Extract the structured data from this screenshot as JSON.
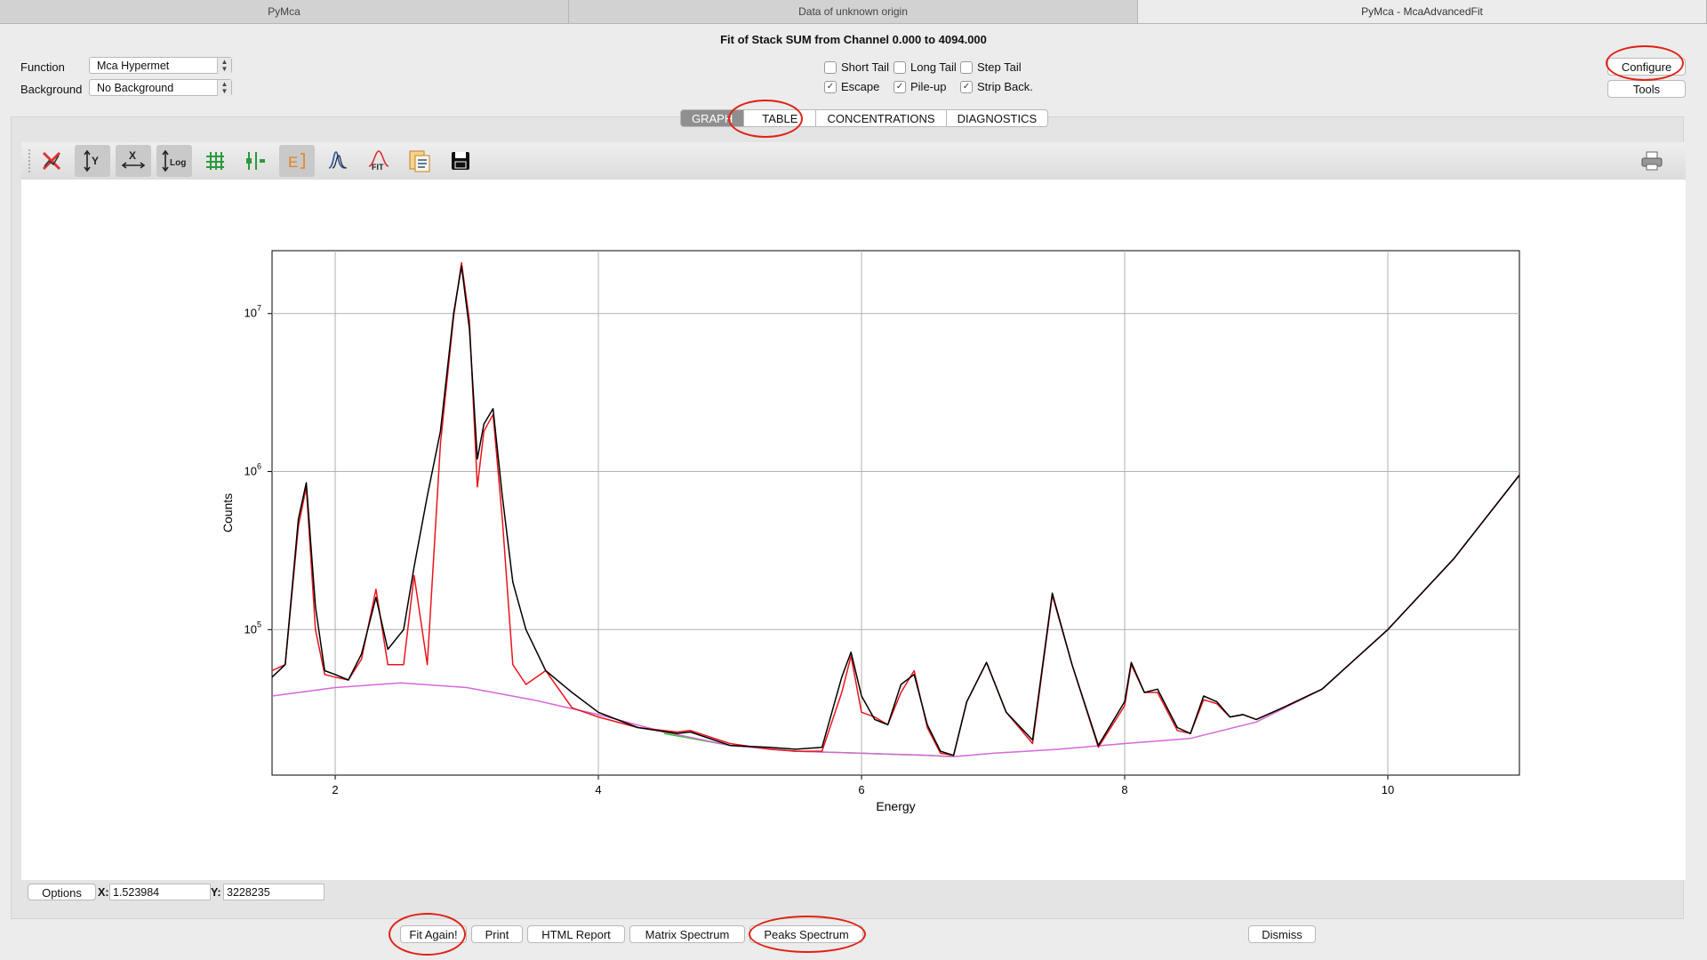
{
  "window_tabs": [
    "PyMca",
    "Data of unknown origin",
    "PyMca - McaAdvancedFit"
  ],
  "title": "Fit of Stack SUM from Channel 0.000 to 4094.000",
  "function": {
    "label": "Function",
    "value": "Mca Hypermet"
  },
  "background": {
    "label": "Background",
    "value": "No Background"
  },
  "options": [
    {
      "label": "Short Tail",
      "checked": false
    },
    {
      "label": "Long Tail",
      "checked": false
    },
    {
      "label": "Step Tail",
      "checked": false
    },
    {
      "label": "Escape",
      "checked": true
    },
    {
      "label": "Pile-up",
      "checked": true
    },
    {
      "label": "Strip Back.",
      "checked": true
    }
  ],
  "configure_label": "Configure",
  "tools_label": "Tools",
  "view_tabs": [
    "GRAPH",
    "TABLE",
    "CONCENTRATIONS",
    "DIAGNOSTICS"
  ],
  "selected_view_tab": "GRAPH",
  "toolbar_icons": [
    "reset-zoom-icon",
    "autoscale-y-icon",
    "autoscale-x-icon",
    "log-y-icon",
    "grid-icon",
    "curve-style-icon",
    "energy-axis-icon",
    "peak-icon",
    "fit-icon",
    "report-icon",
    "save-icon",
    "print-icon"
  ],
  "status": {
    "options_label": "Options",
    "x_label": "X:",
    "x_value": "1.523984",
    "y_label": "Y:",
    "y_value": "3228235"
  },
  "actions": {
    "fit_again": "Fit Again!",
    "print": "Print",
    "html_report": "HTML Report",
    "matrix_spectrum": "Matrix Spectrum",
    "peaks_spectrum": "Peaks Spectrum",
    "dismiss": "Dismiss"
  },
  "colors": {
    "data": "#000000",
    "fit": "#e8151b",
    "continuum": "#d668d6",
    "pileup": "#22d022",
    "annotation": "#e02214"
  },
  "chart_data": {
    "type": "line",
    "xlabel": "Energy",
    "ylabel": "Counts",
    "yscale": "log",
    "xlim": [
      1.52,
      11.0
    ],
    "ylim": [
      12000,
      25000000
    ],
    "xticks": [
      2,
      4,
      6,
      8,
      10
    ],
    "yticks": [
      "10^5",
      "10^6",
      "10^7"
    ],
    "grid": true,
    "series": [
      {
        "name": "data",
        "x": [
          1.52,
          1.62,
          1.72,
          1.78,
          1.85,
          1.92,
          2.0,
          2.1,
          2.2,
          2.31,
          2.4,
          2.52,
          2.6,
          2.7,
          2.8,
          2.9,
          2.96,
          3.02,
          3.08,
          3.13,
          3.2,
          3.27,
          3.35,
          3.45,
          3.6,
          3.8,
          4.0,
          4.3,
          4.6,
          4.7,
          5.0,
          5.3,
          5.5,
          5.7,
          5.85,
          5.92,
          6.0,
          6.1,
          6.2,
          6.3,
          6.4,
          6.5,
          6.6,
          6.7,
          6.8,
          6.95,
          7.1,
          7.3,
          7.45,
          7.6,
          7.8,
          8.0,
          8.05,
          8.15,
          8.25,
          8.4,
          8.5,
          8.6,
          8.7,
          8.8,
          8.9,
          9.0,
          9.2,
          9.5,
          10.0,
          10.5,
          11.0
        ],
        "y": [
          50000,
          60000,
          500000,
          850000,
          140000,
          55000,
          52000,
          48000,
          70000,
          160000,
          75000,
          100000,
          250000,
          700000,
          1800000,
          10000000,
          20000000,
          8000000,
          1200000,
          2000000,
          2500000,
          700000,
          200000,
          100000,
          55000,
          40000,
          30000,
          24000,
          22000,
          22500,
          18500,
          18000,
          17500,
          18000,
          50000,
          72000,
          38000,
          27000,
          25000,
          45000,
          52000,
          25000,
          17000,
          16000,
          35000,
          62000,
          30000,
          20000,
          170000,
          60000,
          18500,
          35000,
          62000,
          40000,
          42000,
          24000,
          22000,
          38000,
          35000,
          28000,
          29000,
          27000,
          32000,
          42000,
          100000,
          280000,
          950000
        ]
      },
      {
        "name": "fit",
        "x": [
          1.52,
          1.62,
          1.72,
          1.78,
          1.85,
          1.92,
          2.0,
          2.1,
          2.2,
          2.31,
          2.4,
          2.52,
          2.6,
          2.7,
          2.8,
          2.9,
          2.96,
          3.02,
          3.08,
          3.13,
          3.2,
          3.27,
          3.35,
          3.45,
          3.6,
          3.8,
          4.0,
          4.3,
          4.6,
          4.7,
          5.0,
          5.3,
          5.5,
          5.7,
          5.85,
          5.92,
          6.0,
          6.1,
          6.2,
          6.3,
          6.4,
          6.5,
          6.6,
          6.7,
          6.8,
          6.95,
          7.1,
          7.3,
          7.45,
          7.6,
          7.8,
          8.0,
          8.05,
          8.15,
          8.25,
          8.4,
          8.5,
          8.6,
          8.7,
          8.8,
          8.9,
          9.0,
          9.2,
          9.5,
          10.0,
          10.5,
          11.0
        ],
        "y": [
          55000,
          60000,
          450000,
          800000,
          100000,
          52000,
          50000,
          48000,
          65000,
          180000,
          60000,
          60000,
          220000,
          60000,
          1500000,
          9500000,
          21000000,
          9000000,
          800000,
          1800000,
          2300000,
          500000,
          60000,
          45000,
          55000,
          32000,
          28000,
          24000,
          22500,
          23000,
          19000,
          17500,
          17000,
          17000,
          40000,
          68000,
          30000,
          28000,
          25000,
          40000,
          55000,
          24000,
          16500,
          16000,
          35000,
          62000,
          30000,
          19000,
          165000,
          60000,
          18000,
          33000,
          60000,
          40000,
          40000,
          23000,
          22000,
          36000,
          34000,
          28000,
          29000,
          27000,
          32000,
          42000,
          100000,
          280000,
          950000
        ]
      },
      {
        "name": "continuum",
        "x": [
          1.52,
          2.0,
          2.5,
          3.0,
          3.5,
          4.0,
          4.5,
          5.0,
          5.5,
          6.0,
          6.5,
          6.7,
          7.0,
          7.5,
          8.0,
          8.5,
          9.0,
          9.5,
          10.0,
          10.5,
          11.0
        ],
        "y": [
          38000,
          43000,
          46000,
          43000,
          36000,
          29000,
          22500,
          18500,
          17000,
          16500,
          16000,
          15700,
          16500,
          17500,
          19000,
          20500,
          26000,
          42000,
          100000,
          280000,
          950000
        ]
      },
      {
        "name": "pileup",
        "x": [
          4.5,
          5.0,
          5.5,
          6.0,
          6.5,
          6.7
        ],
        "y": [
          22000,
          18500,
          17000,
          16500,
          16000,
          15700
        ]
      }
    ]
  }
}
